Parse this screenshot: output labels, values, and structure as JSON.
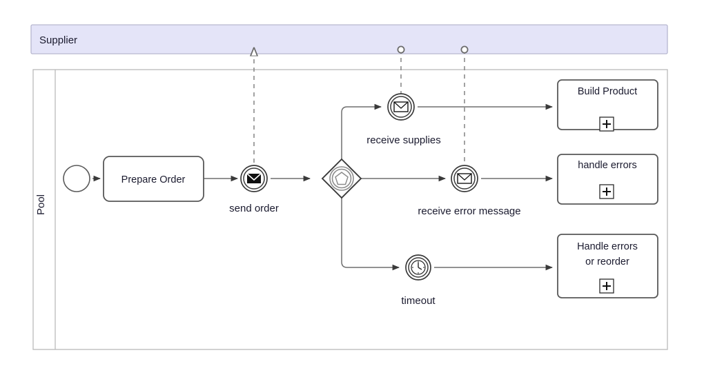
{
  "diagram": {
    "type": "bpmn-collaboration",
    "background": "#ffffff",
    "stroke": "#595959",
    "stroke_light": "#9a9a9a",
    "pool_header_fill": "#e4e4f8"
  },
  "pools": [
    {
      "id": "supplier",
      "name": "Supplier",
      "collapsed": true,
      "fill": "#e4e4f8"
    },
    {
      "id": "pool",
      "name": "Pool",
      "collapsed": false,
      "fill": "#ffffff"
    }
  ],
  "nodes": [
    {
      "id": "start",
      "kind": "start-event",
      "label": ""
    },
    {
      "id": "prepare-order",
      "kind": "task",
      "label": "Prepare Order"
    },
    {
      "id": "send-order",
      "kind": "message-throw-event",
      "label": "send order"
    },
    {
      "id": "gateway",
      "kind": "event-based-gateway",
      "label": ""
    },
    {
      "id": "receive-supplies",
      "kind": "message-catch-event",
      "label": "receive supplies"
    },
    {
      "id": "receive-error",
      "kind": "message-catch-event",
      "label": "receive error message"
    },
    {
      "id": "timeout",
      "kind": "timer-catch-event",
      "label": "timeout"
    },
    {
      "id": "build-product",
      "kind": "collapsed-subprocess",
      "label": "Build Product",
      "marker": "+"
    },
    {
      "id": "handle-errors",
      "kind": "collapsed-subprocess",
      "label": "handle errors",
      "marker": "+"
    },
    {
      "id": "handle-reorder",
      "kind": "collapsed-subprocess",
      "label": "Handle errors\nor reorder",
      "marker": "+",
      "label_line1": "Handle errors",
      "label_line2": "or reorder"
    }
  ],
  "flows": [
    {
      "from": "start",
      "to": "prepare-order",
      "type": "sequence"
    },
    {
      "from": "prepare-order",
      "to": "send-order",
      "type": "sequence"
    },
    {
      "from": "send-order",
      "to": "gateway",
      "type": "sequence"
    },
    {
      "from": "gateway",
      "to": "receive-supplies",
      "type": "sequence"
    },
    {
      "from": "gateway",
      "to": "receive-error",
      "type": "sequence"
    },
    {
      "from": "gateway",
      "to": "timeout",
      "type": "sequence"
    },
    {
      "from": "receive-supplies",
      "to": "build-product",
      "type": "sequence"
    },
    {
      "from": "receive-error",
      "to": "handle-errors",
      "type": "sequence"
    },
    {
      "from": "timeout",
      "to": "handle-reorder",
      "type": "sequence"
    },
    {
      "from": "send-order",
      "to": "supplier",
      "type": "message",
      "marker": "triangle"
    },
    {
      "from": "supplier",
      "to": "receive-supplies",
      "type": "message",
      "marker": "circle"
    },
    {
      "from": "supplier",
      "to": "receive-error",
      "type": "message",
      "marker": "circle"
    }
  ]
}
